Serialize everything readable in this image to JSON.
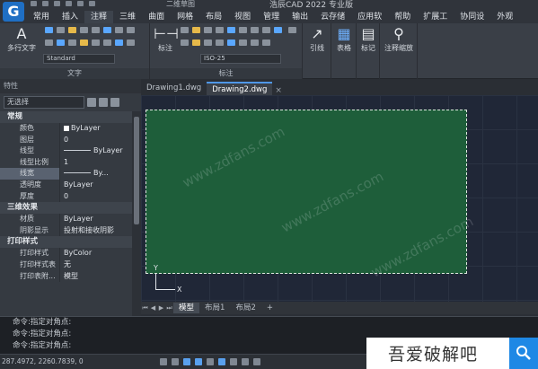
{
  "window": {
    "title": "浩辰CAD 2022 专业版",
    "workspace": "二维草图",
    "logo": "G"
  },
  "menu": [
    "常用",
    "插入",
    "注释",
    "三维",
    "曲面",
    "网格",
    "布局",
    "视图",
    "管理",
    "输出",
    "云存储",
    "应用软",
    "帮助",
    "扩展工",
    "协同设",
    "外观"
  ],
  "menu_active_index": 2,
  "ribbon": {
    "text_panel": {
      "big_label": "多行文字",
      "style_value": "Standard",
      "panel_label": "文字"
    },
    "dim_panel": {
      "big_label": "标注",
      "style_value": "ISO-25",
      "panel_label": "标注"
    },
    "leader_label": "引线",
    "table_label": "表格",
    "mark_label": "标记",
    "scale_label": "注释缩放"
  },
  "properties": {
    "header": "特性",
    "selection": "无选择",
    "sections": [
      {
        "title": "常规",
        "rows": [
          {
            "key": "颜色",
            "value": "ByLayer",
            "kind": "color"
          },
          {
            "key": "图层",
            "value": "0"
          },
          {
            "key": "线型",
            "value": "ByLayer",
            "kind": "line"
          },
          {
            "key": "线型比例",
            "value": "1"
          },
          {
            "key": "线宽",
            "value": "By...",
            "kind": "line",
            "highlight": true
          },
          {
            "key": "透明度",
            "value": "ByLayer"
          },
          {
            "key": "厚度",
            "value": "0"
          }
        ]
      },
      {
        "title": "三维效果",
        "rows": [
          {
            "key": "材质",
            "value": "ByLayer"
          },
          {
            "key": "阴影显示",
            "value": "投射和接收阴影"
          }
        ]
      },
      {
        "title": "打印样式",
        "rows": [
          {
            "key": "打印样式",
            "value": "ByColor"
          },
          {
            "key": "打印样式表",
            "value": "无"
          },
          {
            "key": "打印表附...",
            "value": "模型"
          }
        ]
      }
    ]
  },
  "doc_tabs": [
    {
      "label": "Drawing1.dwg",
      "active": false
    },
    {
      "label": "Drawing2.dwg",
      "active": true
    }
  ],
  "doc_tab_close": "×",
  "ucs": {
    "x": "X",
    "y": "Y"
  },
  "layout_tabs": [
    {
      "label": "模型",
      "active": true
    },
    {
      "label": "布局1",
      "active": false
    },
    {
      "label": "布局2",
      "active": false
    },
    {
      "label": "+",
      "active": false
    }
  ],
  "command_lines": [
    "命令:指定对角点:",
    "命令:指定对角点:",
    "命令:指定对角点:"
  ],
  "status": {
    "coords": "287.4972, 2260.7839, 0"
  },
  "watermark": {
    "text": "吾爱破解吧",
    "diag": "www.zdfans.com"
  },
  "colors": {
    "drawing_fill": "#1e5e3a",
    "canvas_bg": "#202737",
    "accent": "#4f97e8"
  }
}
